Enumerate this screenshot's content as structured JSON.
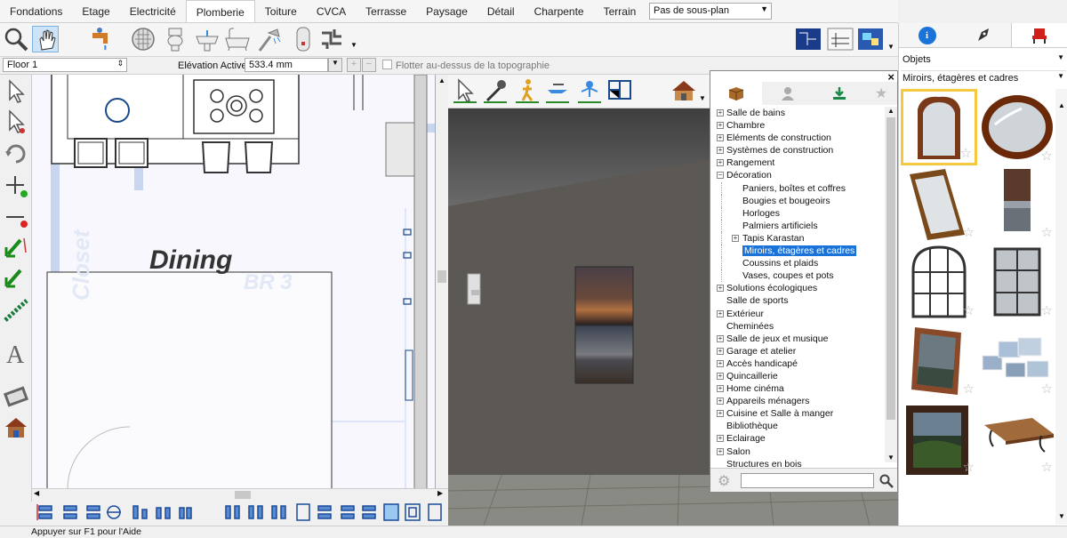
{
  "menu": {
    "tabs": [
      "Fondations",
      "Etage",
      "Electricité",
      "Plomberie",
      "Toiture",
      "CVCA",
      "Terrasse",
      "Paysage",
      "Détail",
      "Charpente",
      "Terrain"
    ],
    "active_tab": "Plomberie",
    "view_select": "Pas de sous-plan"
  },
  "propbar": {
    "floor": "Floor 1",
    "elevation_label": "Elévation Active:",
    "elevation_value": "533.4 mm",
    "float_label": "Flotter au-dessus de la topographie"
  },
  "plan": {
    "room_dining": "Dining",
    "room_closet": "Closet",
    "room_br3": "BR 3"
  },
  "catalog": {
    "tree": [
      {
        "label": "Salle de bains",
        "level": 0,
        "expander": "+"
      },
      {
        "label": "Chambre",
        "level": 0,
        "expander": "+"
      },
      {
        "label": "Eléments de construction",
        "level": 0,
        "expander": "+"
      },
      {
        "label": "Systèmes de construction",
        "level": 0,
        "expander": "+"
      },
      {
        "label": "Rangement",
        "level": 0,
        "expander": "+"
      },
      {
        "label": "Décoration",
        "level": 0,
        "expander": "-"
      },
      {
        "label": "Paniers, boîtes et coffres",
        "level": 1,
        "expander": ""
      },
      {
        "label": "Bougies et bougeoirs",
        "level": 1,
        "expander": ""
      },
      {
        "label": "Horloges",
        "level": 1,
        "expander": ""
      },
      {
        "label": "Palmiers artificiels",
        "level": 1,
        "expander": ""
      },
      {
        "label": "Tapis Karastan",
        "level": 1,
        "expander": "+"
      },
      {
        "label": "Miroirs, étagères et cadres",
        "level": 1,
        "expander": "",
        "selected": true
      },
      {
        "label": "Coussins et plaids",
        "level": 1,
        "expander": ""
      },
      {
        "label": "Vases, coupes et pots",
        "level": 1,
        "expander": ""
      },
      {
        "label": "Solutions écologiques",
        "level": 0,
        "expander": "+"
      },
      {
        "label": "Salle de sports",
        "level": 0,
        "expander": ""
      },
      {
        "label": "Extérieur",
        "level": 0,
        "expander": "+"
      },
      {
        "label": "Cheminées",
        "level": 0,
        "expander": ""
      },
      {
        "label": "Salle de jeux et musique",
        "level": 0,
        "expander": "+"
      },
      {
        "label": "Garage et atelier",
        "level": 0,
        "expander": "+"
      },
      {
        "label": "Accès handicapé",
        "level": 0,
        "expander": "+"
      },
      {
        "label": "Quincaillerie",
        "level": 0,
        "expander": "+"
      },
      {
        "label": "Home cinéma",
        "level": 0,
        "expander": "+"
      },
      {
        "label": "Appareils ménagers",
        "level": 0,
        "expander": "+"
      },
      {
        "label": "Cuisine et Salle à manger",
        "level": 0,
        "expander": "+"
      },
      {
        "label": "Bibliothèque",
        "level": 0,
        "expander": ""
      },
      {
        "label": "Eclairage",
        "level": 0,
        "expander": "+"
      },
      {
        "label": "Salon",
        "level": 0,
        "expander": "+"
      },
      {
        "label": "Structures en bois",
        "level": 0,
        "expander": ""
      }
    ],
    "search_value": "",
    "close_glyph": "×"
  },
  "right_panel": {
    "objects_label": "Objets",
    "category_select": "Miroirs, étagères et cadres",
    "star_glyph": "☆"
  },
  "status": {
    "help_text": "Appuyer sur F1 pour l'Aide"
  },
  "colors": {
    "accent_blue": "#1a73d9",
    "selected_thumb_border": "#f5c842",
    "wall_3d": "#5a5753"
  }
}
